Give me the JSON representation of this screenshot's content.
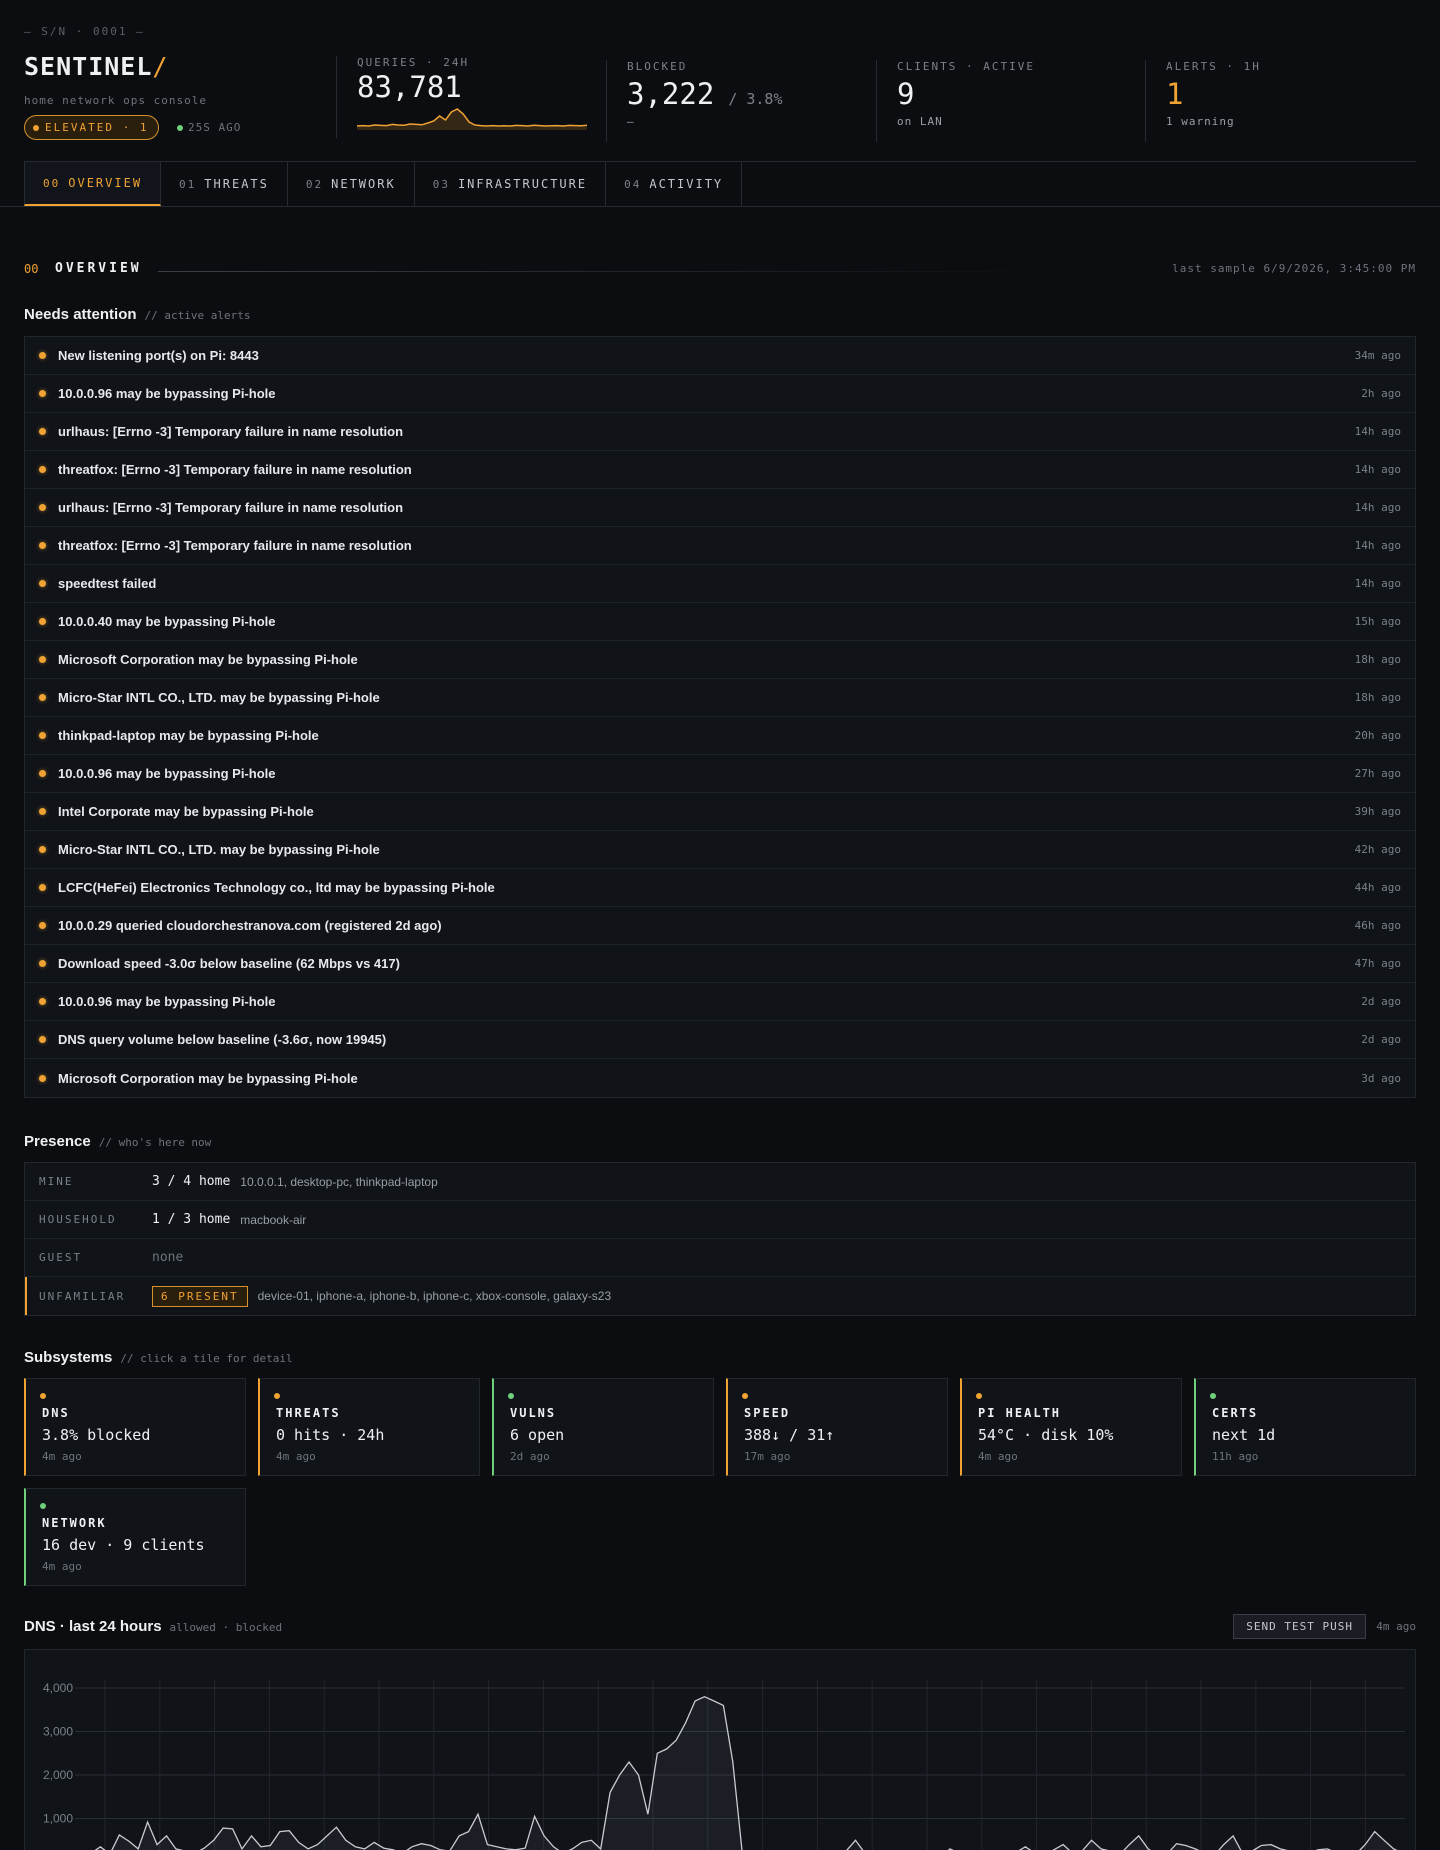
{
  "header": {
    "serial": "— S/N · 0001 —",
    "brand": "SENTINEL",
    "brand_slash": "/",
    "subtitle": "home network ops console",
    "status_badge": "ELEVATED · 1",
    "last_seen": "25S AGO"
  },
  "metrics": {
    "queries": {
      "label": "QUERIES · 24H",
      "value": "83,781"
    },
    "blocked": {
      "label": "BLOCKED",
      "value": "3,222",
      "pct": "/ 3.8%",
      "sub": "—"
    },
    "clients": {
      "label": "CLIENTS · ACTIVE",
      "value": "9",
      "sub": "on LAN"
    },
    "alerts": {
      "label": "ALERTS · 1H",
      "value": "1",
      "sub": "1 warning"
    }
  },
  "sparkline": [
    0.1,
    0.12,
    0.1,
    0.15,
    0.13,
    0.12,
    0.18,
    0.15,
    0.14,
    0.2,
    0.18,
    0.16,
    0.25,
    0.35,
    0.6,
    0.4,
    0.8,
    0.95,
    0.7,
    0.3,
    0.15,
    0.12,
    0.1,
    0.12,
    0.1,
    0.11,
    0.1,
    0.13,
    0.12,
    0.1,
    0.14,
    0.12,
    0.1,
    0.11,
    0.12,
    0.1,
    0.13,
    0.12,
    0.11,
    0.14
  ],
  "tabs": [
    {
      "num": "00",
      "label": "OVERVIEW"
    },
    {
      "num": "01",
      "label": "THREATS"
    },
    {
      "num": "02",
      "label": "NETWORK"
    },
    {
      "num": "03",
      "label": "INFRASTRUCTURE"
    },
    {
      "num": "04",
      "label": "ACTIVITY"
    }
  ],
  "section": {
    "num": "00",
    "title": "OVERVIEW",
    "timestamp": "last sample 6/9/2026, 3:45:00 PM"
  },
  "needs_attention": {
    "title": "Needs attention",
    "comment": "// active alerts",
    "items": [
      {
        "text": "New listening port(s) on Pi: 8443",
        "time": "34m ago"
      },
      {
        "text": "10.0.0.96 may be bypassing Pi-hole",
        "time": "2h ago"
      },
      {
        "text": "urlhaus: [Errno -3] Temporary failure in name resolution",
        "time": "14h ago"
      },
      {
        "text": "threatfox: [Errno -3] Temporary failure in name resolution",
        "time": "14h ago"
      },
      {
        "text": "urlhaus: [Errno -3] Temporary failure in name resolution",
        "time": "14h ago"
      },
      {
        "text": "threatfox: [Errno -3] Temporary failure in name resolution",
        "time": "14h ago"
      },
      {
        "text": "speedtest failed",
        "time": "14h ago"
      },
      {
        "text": "10.0.0.40 may be bypassing Pi-hole",
        "time": "15h ago"
      },
      {
        "text": "Microsoft Corporation may be bypassing Pi-hole",
        "time": "18h ago"
      },
      {
        "text": "Micro-Star INTL CO., LTD. may be bypassing Pi-hole",
        "time": "18h ago"
      },
      {
        "text": "thinkpad-laptop may be bypassing Pi-hole",
        "time": "20h ago"
      },
      {
        "text": "10.0.0.96 may be bypassing Pi-hole",
        "time": "27h ago"
      },
      {
        "text": "Intel Corporate may be bypassing Pi-hole",
        "time": "39h ago"
      },
      {
        "text": "Micro-Star INTL CO., LTD. may be bypassing Pi-hole",
        "time": "42h ago"
      },
      {
        "text": "LCFC(HeFei) Electronics Technology co., ltd may be bypassing Pi-hole",
        "time": "44h ago"
      },
      {
        "text": "10.0.0.29 queried cloudorchestranova.com (registered 2d ago)",
        "time": "46h ago"
      },
      {
        "text": "Download speed -3.0σ below baseline (62 Mbps vs 417)",
        "time": "47h ago"
      },
      {
        "text": "10.0.0.96 may be bypassing Pi-hole",
        "time": "2d ago"
      },
      {
        "text": "DNS query volume below baseline (-3.6σ, now 19945)",
        "time": "2d ago"
      },
      {
        "text": "Microsoft Corporation may be bypassing Pi-hole",
        "time": "3d ago"
      }
    ]
  },
  "presence": {
    "title": "Presence",
    "comment": "// who's here now",
    "mine": {
      "label": "MINE",
      "count": "3 / 4 home",
      "names": "10.0.0.1, desktop-pc, thinkpad-laptop"
    },
    "household": {
      "label": "HOUSEHOLD",
      "count": "1 / 3 home",
      "names": "macbook-air"
    },
    "guest": {
      "label": "GUEST",
      "value": "none"
    },
    "unfamiliar": {
      "label": "UNFAMILIAR",
      "badge": "6 PRESENT",
      "names": "device-01, iphone-a, iphone-b, iphone-c, xbox-console, galaxy-s23"
    }
  },
  "subsystems": {
    "title": "Subsystems",
    "comment": "// click a tile for detail",
    "tiles": [
      {
        "name": "DNS",
        "value": "3.8% blocked",
        "time": "4m ago",
        "status": "amber"
      },
      {
        "name": "THREATS",
        "value": "0 hits · 24h",
        "time": "4m ago",
        "status": "amber"
      },
      {
        "name": "VULNS",
        "value": "6 open",
        "time": "2d ago",
        "status": "green"
      },
      {
        "name": "SPEED",
        "value": "388↓ / 31↑",
        "time": "17m ago",
        "status": "amber"
      },
      {
        "name": "PI HEALTH",
        "value": "54°C · disk 10%",
        "time": "4m ago",
        "status": "amber"
      },
      {
        "name": "CERTS",
        "value": "next 1d",
        "time": "11h ago",
        "status": "green"
      },
      {
        "name": "NETWORK",
        "value": "16 dev · 9 clients",
        "time": "4m ago",
        "status": "green"
      }
    ]
  },
  "dns_chart": {
    "title": "DNS · last 24 hours",
    "legend": "allowed · blocked",
    "button": "SEND TEST PUSH",
    "time": "4m ago"
  },
  "chart_data": {
    "type": "area",
    "title": "DNS · last 24 hours",
    "ylim": [
      0,
      4000
    ],
    "yticks": [
      "4,000",
      "3,000",
      "2,000",
      "1,000"
    ],
    "series": [
      {
        "name": "allowed",
        "values": [
          200,
          350,
          180,
          620,
          480,
          300,
          920,
          400,
          600,
          300,
          250,
          200,
          320,
          500,
          780,
          760,
          300,
          600,
          350,
          380,
          700,
          720,
          450,
          300,
          400,
          600,
          800,
          500,
          350,
          300,
          450,
          320,
          280,
          200,
          350,
          420,
          380,
          280,
          250,
          600,
          700,
          1100,
          400,
          350,
          300,
          280,
          320,
          1050,
          600,
          350,
          200,
          300,
          450,
          500,
          300,
          1600,
          2000,
          2300,
          2000,
          1100,
          2500,
          2600,
          2800,
          3200,
          3700,
          3800,
          3700,
          3600,
          2300,
          200,
          250,
          210,
          180,
          150,
          220,
          160,
          100,
          200,
          260,
          180,
          250,
          500,
          200,
          150,
          160,
          180,
          200,
          150,
          220,
          170,
          100,
          300,
          200,
          150,
          250,
          180,
          200,
          160,
          220,
          350,
          200,
          150,
          280,
          400,
          200,
          250,
          500,
          300,
          250,
          170,
          400,
          600,
          300,
          150,
          180,
          420,
          380,
          300,
          200,
          150,
          400,
          600,
          200,
          250,
          380,
          400,
          300,
          250,
          180,
          200,
          280,
          300,
          200,
          150,
          180,
          400,
          700,
          500,
          300,
          200
        ]
      }
    ]
  },
  "colors": {
    "accent": "#f0a233",
    "ok": "#6fcf7b",
    "bg": "#0b0d10",
    "panel": "#101318"
  }
}
